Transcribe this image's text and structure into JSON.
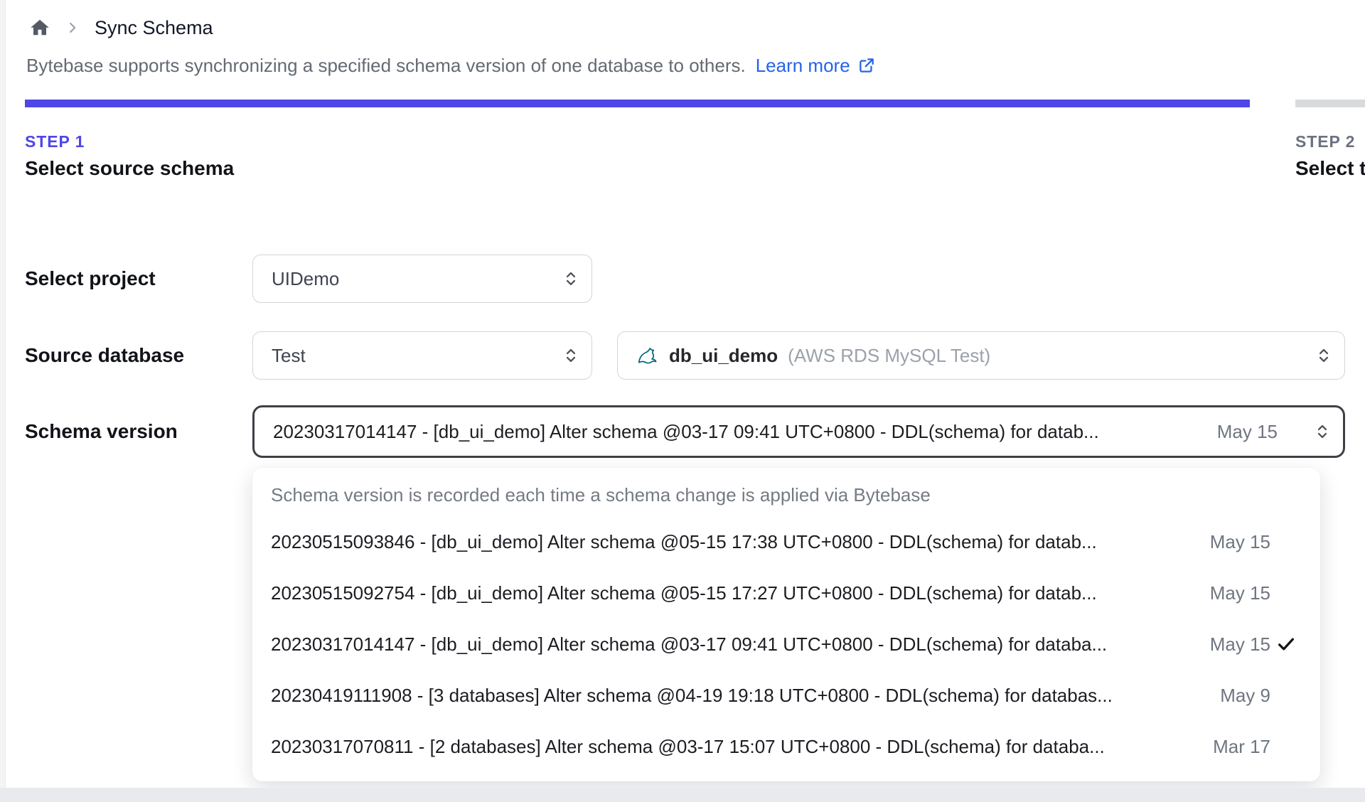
{
  "breadcrumb": {
    "title": "Sync Schema"
  },
  "intro": {
    "text": "Bytebase supports synchronizing a specified schema version of one database to others.",
    "link_label": "Learn more"
  },
  "steps": [
    {
      "label": "STEP 1",
      "title": "Select source schema",
      "state": "active"
    },
    {
      "label": "STEP 2",
      "title": "Select t",
      "state": "upcoming"
    }
  ],
  "form": {
    "project": {
      "label": "Select project",
      "value": "UIDemo"
    },
    "source_database": {
      "label": "Source database",
      "environment_value": "Test",
      "database_value": "db_ui_demo",
      "database_detail": "(AWS RDS MySQL Test)"
    },
    "schema_version": {
      "label": "Schema version",
      "value": "20230317014147 - [db_ui_demo] Alter schema @03-17 09:41 UTC+0800 - DDL(schema) for datab...",
      "date": "May 15"
    }
  },
  "dropdown": {
    "hint": "Schema version is recorded each time a schema change is applied via Bytebase",
    "options": [
      {
        "text": "20230515093846 - [db_ui_demo] Alter schema @05-15 17:38 UTC+0800 - DDL(schema) for datab...",
        "date": "May 15",
        "selected": false
      },
      {
        "text": "20230515092754 - [db_ui_demo] Alter schema @05-15 17:27 UTC+0800 - DDL(schema) for datab...",
        "date": "May 15",
        "selected": false
      },
      {
        "text": "20230317014147 - [db_ui_demo] Alter schema @03-17 09:41 UTC+0800 - DDL(schema) for databa...",
        "date": "May 15",
        "selected": true
      },
      {
        "text": "20230419111908 - [3 databases] Alter schema @04-19 19:18 UTC+0800 - DDL(schema) for databas...",
        "date": "May 9",
        "selected": false
      },
      {
        "text": "20230317070811 - [2 databases] Alter schema @03-17 15:07 UTC+0800 - DDL(schema) for databa...",
        "date": "Mar 17",
        "selected": false
      }
    ]
  },
  "icons": {
    "breadcrumb_home": "home-icon",
    "breadcrumb_separator": "chevron-right-icon",
    "learn_more_external": "external-link-icon",
    "select_caret": "updown-chevron-icon",
    "database_engine": "mysql-dolphin-icon",
    "selected_option": "check-icon"
  },
  "colors": {
    "accent_indigo": "#4f46e5",
    "link_blue": "#2563eb",
    "step_inactive_bar": "#d9dadc",
    "focus_border": "#3f3f46",
    "mysql_teal": "#00687a"
  }
}
